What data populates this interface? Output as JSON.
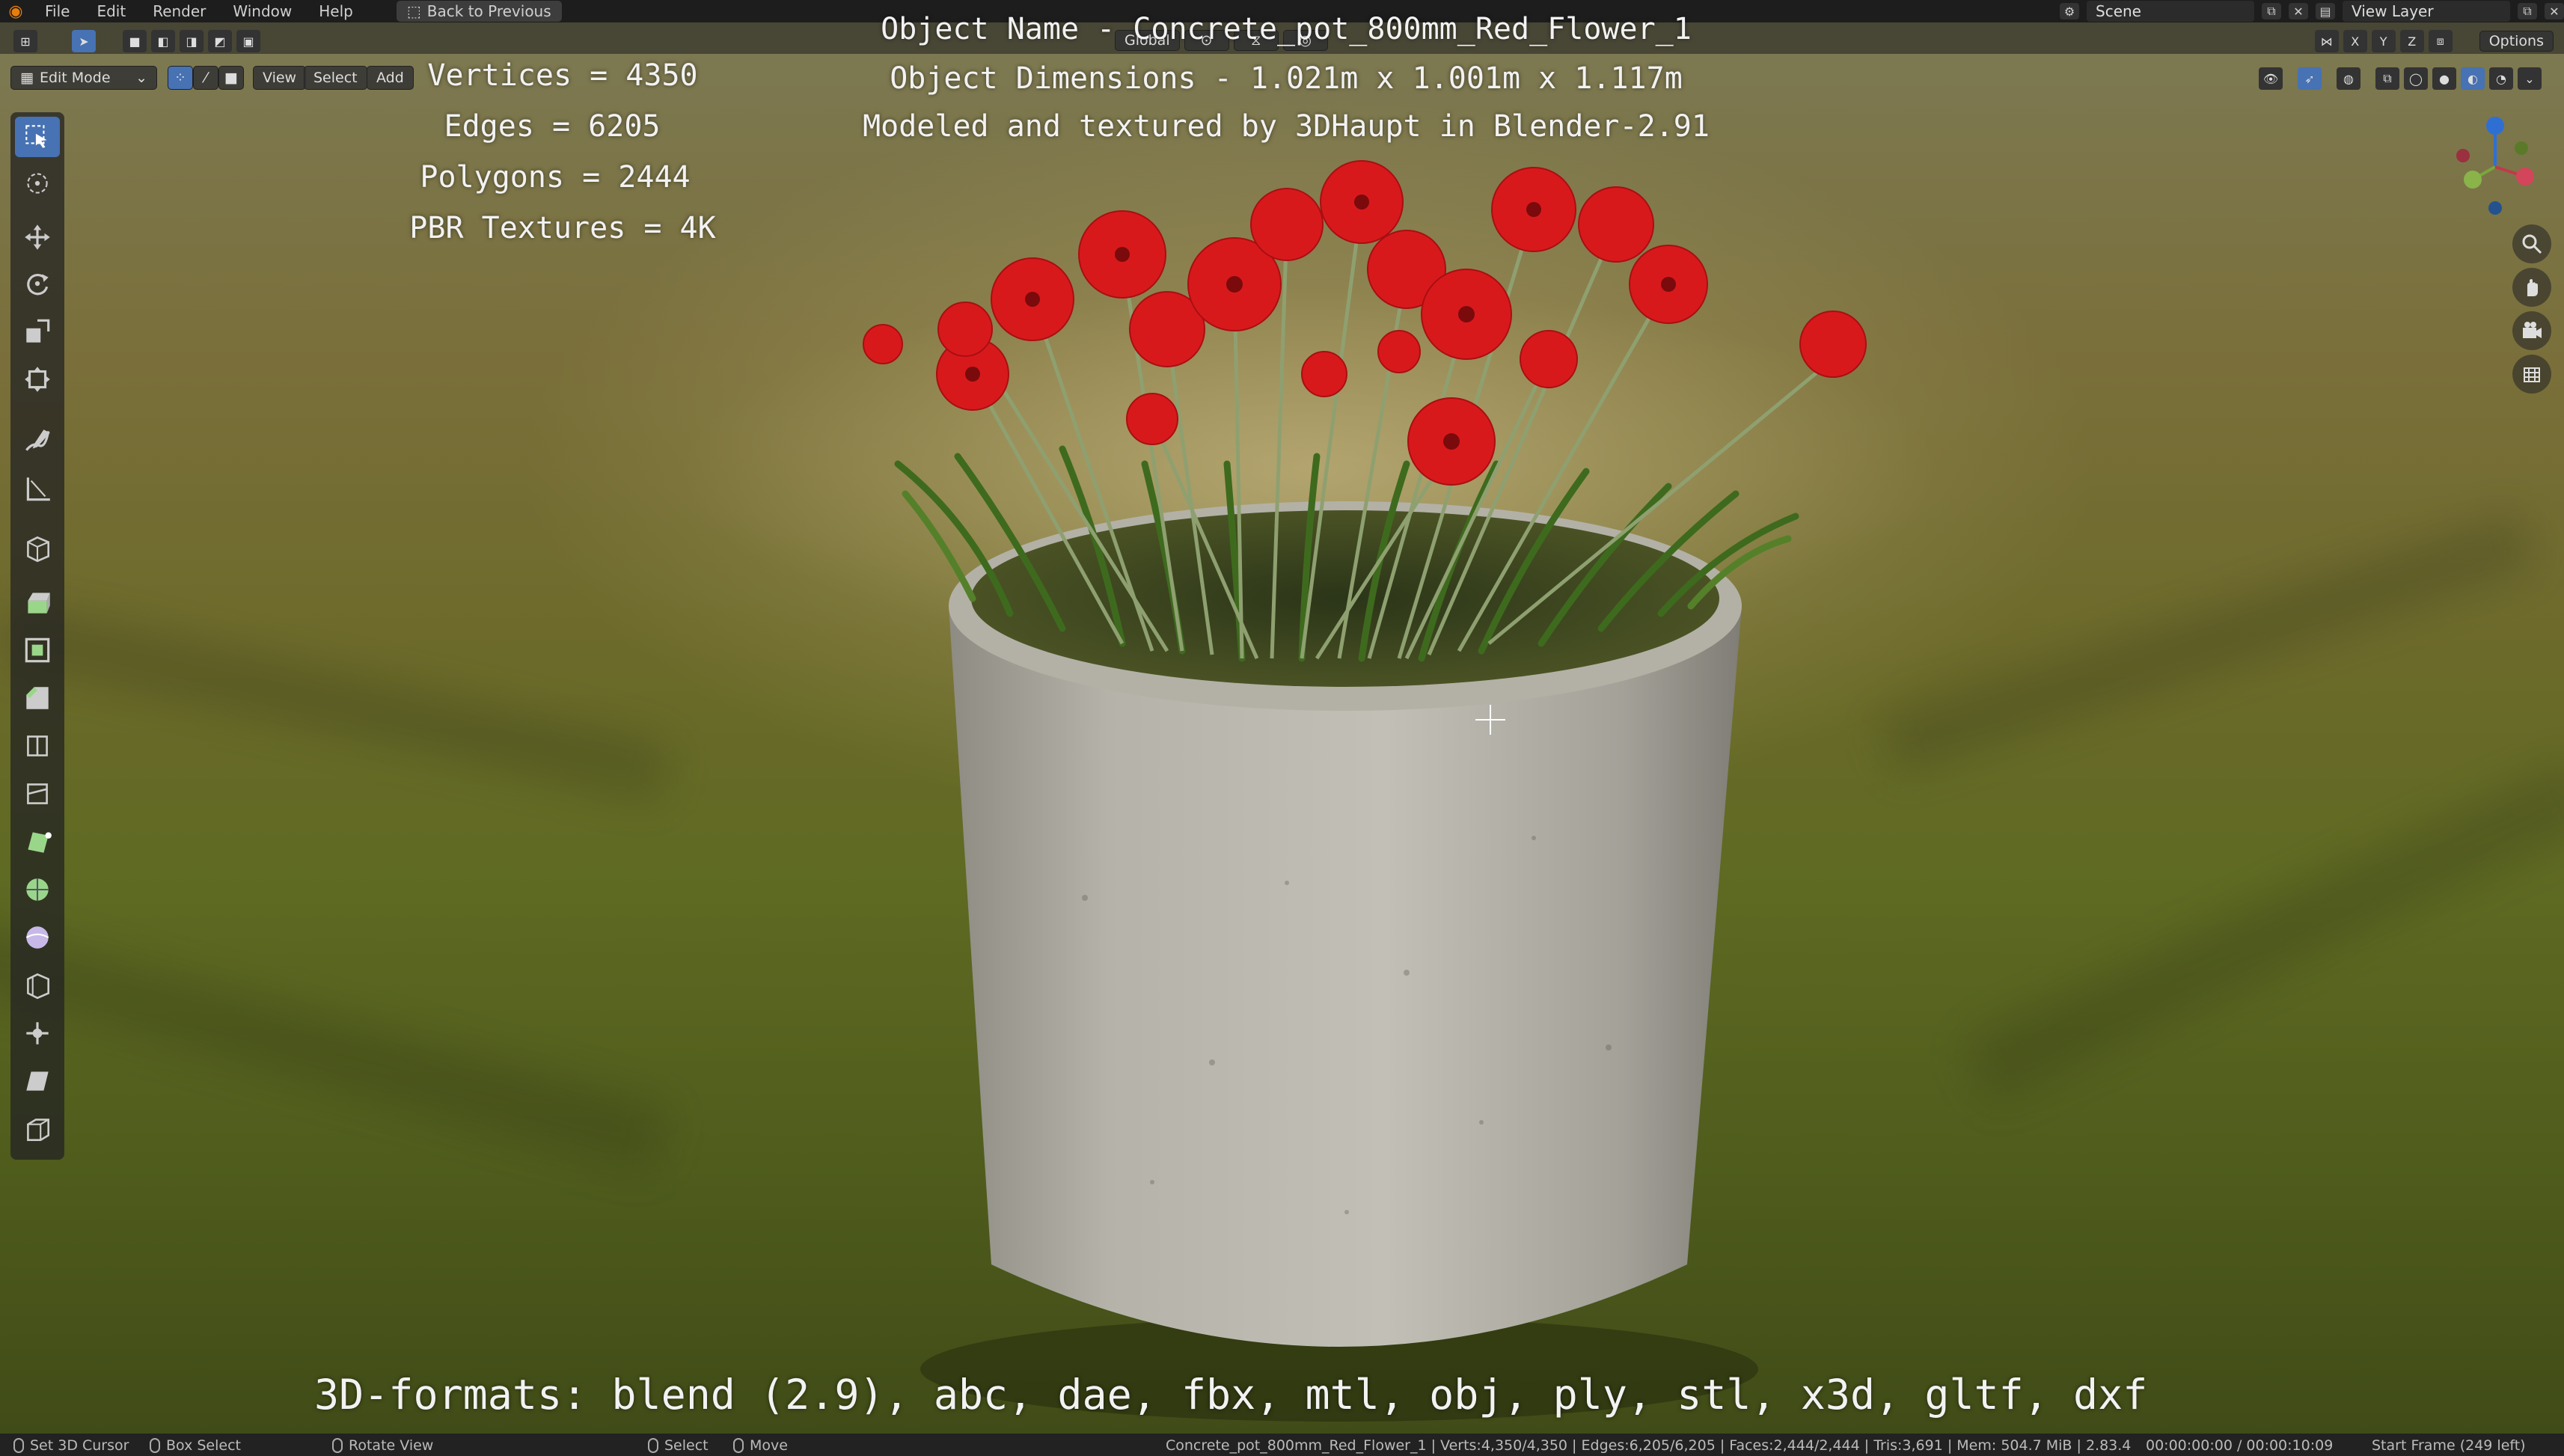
{
  "menu": {
    "items": [
      "File",
      "Edit",
      "Render",
      "Window",
      "Help"
    ],
    "back_label": "Back to Previous",
    "scene_label": "Scene",
    "view_layer_label": "View Layer"
  },
  "viewport_header": {
    "mode": "Edit Mode",
    "menus": [
      "View",
      "Select",
      "Add"
    ],
    "orientation": "Global",
    "axes": [
      "X",
      "Y",
      "Z"
    ],
    "options_label": "Options"
  },
  "overlay": {
    "vertices": "Vertices = 4350",
    "edges": "Edges = 6205",
    "polygons": "Polygons = 2444",
    "textures": "PBR Textures = 4K",
    "object_name": "Object Name - Concrete_pot_800mm_Red_Flower_1",
    "object_dimensions": "Object Dimensions -  1.021m x 1.001m x 1.117m",
    "modeled_by": "Modeled and textured by 3DHaupt in Blender-2.91",
    "formats": "3D-formats: blend (2.9), abc, dae, fbx, mtl, obj, ply, stl, x3d, gltf, dxf"
  },
  "toolbar": {
    "tools": [
      "select-box",
      "cursor",
      "move",
      "rotate",
      "scale",
      "transform",
      "annotate",
      "measure",
      "add-cube",
      "extrude",
      "inset",
      "bevel",
      "loop-cut",
      "knife",
      "poly-build",
      "spin",
      "smooth",
      "edge-slide",
      "shrink-fatten",
      "shear",
      "rip-region"
    ]
  },
  "status": {
    "set_cursor": "Set 3D Cursor",
    "box_select": "Box Select",
    "rotate_view": "Rotate View",
    "select": "Select",
    "move": "Move",
    "stats": "Concrete_pot_800mm_Red_Flower_1 | Verts:4,350/4,350 | Edges:6,205/6,205 | Faces:2,444/2,444 | Tris:3,691 | Mem: 504.7 MiB | 2.83.4",
    "time": "00:00:00:00 / 00:00:10:09",
    "start_frame": "Start Frame (249 left)"
  },
  "colors": {
    "accent": "#4772b3",
    "flower": "#d8191c",
    "pot": "#b9b8ae",
    "grass": "#6c6a2a"
  }
}
